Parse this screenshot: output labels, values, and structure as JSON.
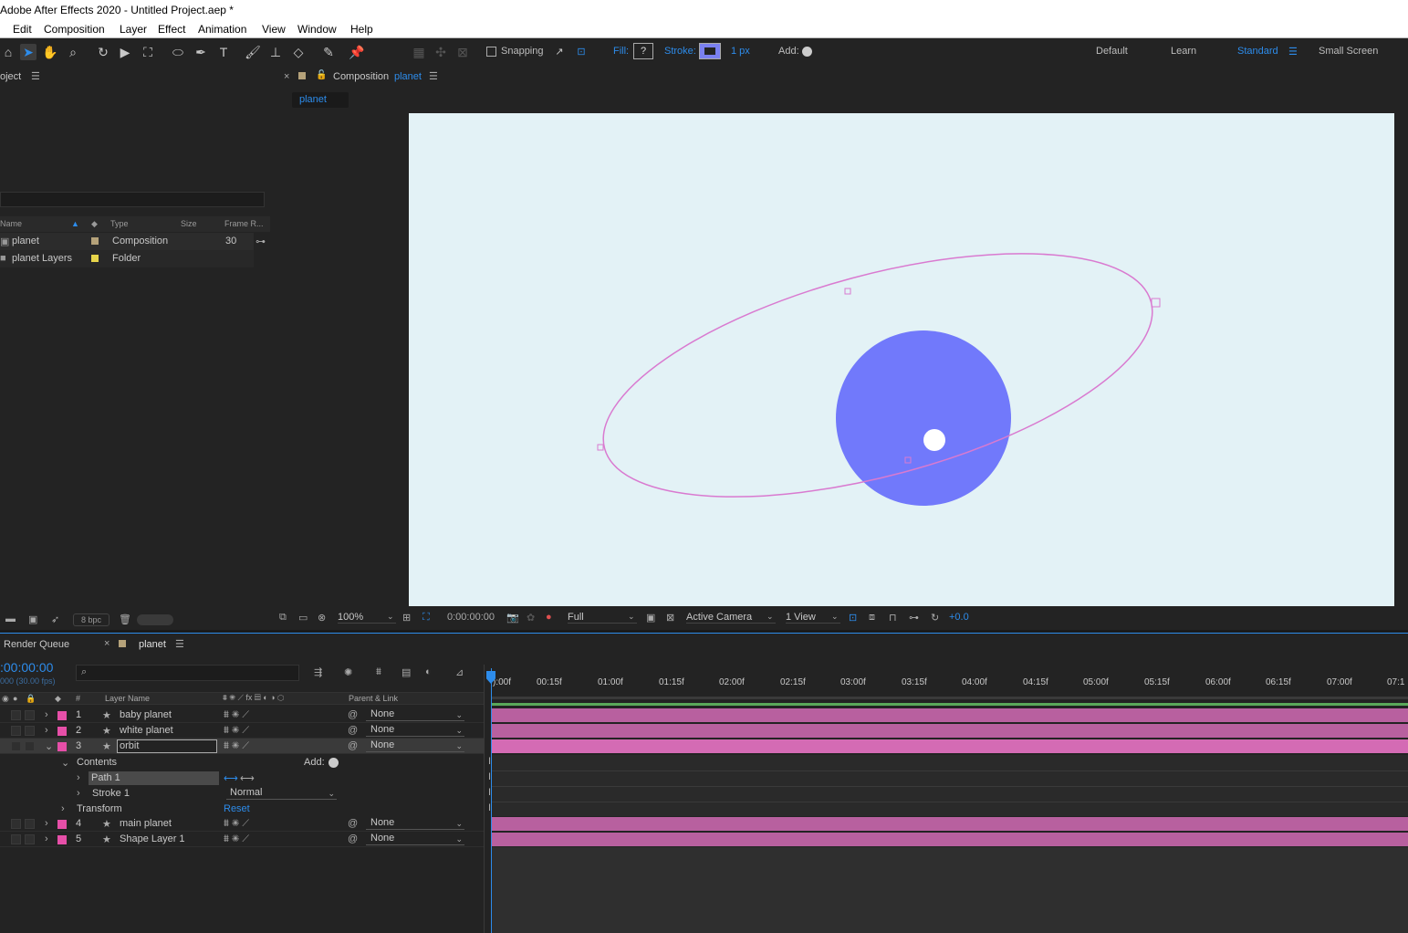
{
  "window": {
    "title": "Adobe After Effects 2020 - Untitled Project.aep *"
  },
  "menu": [
    "Edit",
    "Composition",
    "Layer",
    "Effect",
    "Animation",
    "View",
    "Window",
    "Help"
  ],
  "toolbar": {
    "snapping_label": "Snapping",
    "fill_label": "Fill:",
    "fill_value": "?",
    "stroke_label": "Stroke:",
    "stroke_width": "1 px",
    "add_label": "Add:",
    "workspaces": [
      "Default",
      "Learn",
      "Standard",
      "Small Screen"
    ],
    "active_workspace": "Standard"
  },
  "project": {
    "title": "oject",
    "columns": {
      "name": "Name",
      "type": "Type",
      "size": "Size",
      "frame_rate": "Frame R..."
    },
    "items": [
      {
        "name": "planet",
        "type": "Composition",
        "frame_rate": "30",
        "color": "#b5a27a"
      },
      {
        "name": "planet Layers",
        "type": "Folder",
        "frame_rate": "",
        "color": "#e6d44a"
      }
    ],
    "bpc": "8 bpc"
  },
  "composition": {
    "label": "Composition",
    "name": "planet",
    "tab": "planet",
    "bg_color": "#e3f2f6",
    "planet_color": "#7179fb",
    "orbit_color": "#d97ad0"
  },
  "viewer_bar": {
    "zoom": "100%",
    "timecode": "0:00:00:00",
    "resolution": "Full",
    "camera": "Active Camera",
    "views": "1 View",
    "exposure": "+0.0"
  },
  "timeline": {
    "tabs": [
      "Render Queue",
      "planet"
    ],
    "timecode": ":00:00:00",
    "fps": "000 (30.00 fps)",
    "col_num": "#",
    "col_layer_name": "Layer Name",
    "col_parent": "Parent & Link",
    "ruler": [
      "):00f",
      "00:15f",
      "01:00f",
      "01:15f",
      "02:00f",
      "02:15f",
      "03:00f",
      "03:15f",
      "04:00f",
      "04:15f",
      "05:00f",
      "05:15f",
      "06:00f",
      "06:15f",
      "07:00f",
      "07:1"
    ],
    "layers": [
      {
        "num": "1",
        "name": "baby planet",
        "parent": "None"
      },
      {
        "num": "2",
        "name": "white planet",
        "parent": "None"
      },
      {
        "num": "3",
        "name": "orbit",
        "parent": "None"
      },
      {
        "num": "4",
        "name": "main planet",
        "parent": "None"
      },
      {
        "num": "5",
        "name": "Shape Layer 1",
        "parent": "None"
      }
    ],
    "contents_label": "Contents",
    "add_label": "Add:",
    "path_label": "Path 1",
    "stroke_label": "Stroke 1",
    "blend_mode": "Normal",
    "transform_label": "Transform",
    "reset_label": "Reset",
    "layer_color": "#e64fa8",
    "bar_color": "#b8609f"
  }
}
